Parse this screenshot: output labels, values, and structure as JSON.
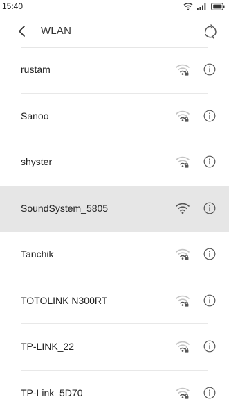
{
  "status_bar": {
    "time": "15:40",
    "icons": [
      "wifi-icon",
      "cellular-signal-icon",
      "battery-icon"
    ]
  },
  "header": {
    "title": "WLAN",
    "back_icon": "chevron-left-icon",
    "refresh_icon": "refresh-icon"
  },
  "networks": [
    {
      "ssid": "rustam",
      "secured": true,
      "strength": "weak",
      "selected": false
    },
    {
      "ssid": "Sanoo",
      "secured": true,
      "strength": "weak",
      "selected": false
    },
    {
      "ssid": "shyster",
      "secured": true,
      "strength": "weak",
      "selected": false
    },
    {
      "ssid": "SoundSystem_5805",
      "secured": false,
      "strength": "strong",
      "selected": true
    },
    {
      "ssid": "Tanchik",
      "secured": true,
      "strength": "weak",
      "selected": false
    },
    {
      "ssid": "TOTOLINK N300RT",
      "secured": true,
      "strength": "weak",
      "selected": false
    },
    {
      "ssid": "TP-LINK_22",
      "secured": true,
      "strength": "weak",
      "selected": false
    },
    {
      "ssid": "TP-Link_5D70",
      "secured": true,
      "strength": "weak",
      "selected": false
    }
  ],
  "colors": {
    "selected_row": "#e6e6e6",
    "icon": "#555555",
    "icon_faded": "#c4c4c4",
    "divider": "#e8e8e8"
  }
}
